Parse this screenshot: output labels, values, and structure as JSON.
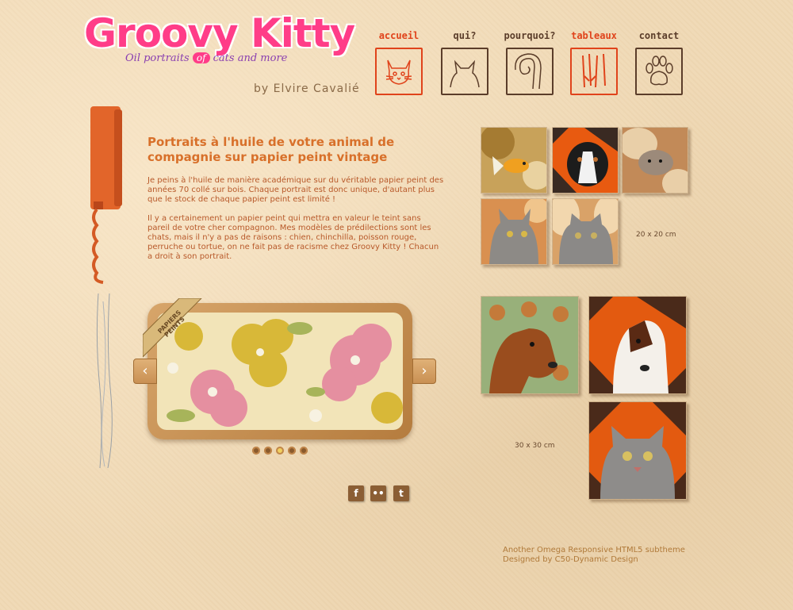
{
  "header": {
    "logo_text": "Groovy Kitty",
    "tagline_before": "Oil portraits ",
    "tagline_of": "of",
    "tagline_after": " cats and more",
    "byline": "by Elvire Cavalié"
  },
  "nav": {
    "items": [
      {
        "label": "accueil",
        "icon": "cat-face-icon",
        "active": true
      },
      {
        "label": "qui?",
        "icon": "cat-silhouette-icon",
        "active": false
      },
      {
        "label": "pourquoi?",
        "icon": "cat-tail-icon",
        "active": false
      },
      {
        "label": "tableaux",
        "icon": "claw-marks-icon",
        "active": true
      },
      {
        "label": "contact",
        "icon": "paw-print-icon",
        "active": false
      }
    ]
  },
  "intro": {
    "title": "Portraits à l'huile de votre animal de compagnie sur papier peint vintage",
    "paragraph1": "Je peins à l'huile de manière académique sur du véritable papier peint des années 70 collé sur bois. Chaque portrait est donc unique, d'autant plus que le stock de chaque papier peint est limité !",
    "paragraph2": "Il y a certainement un papier peint qui mettra en valeur le teint sans pareil de votre cher compagnon. Mes modèles de prédilections sont les chats, mais il n'y a pas de raisons : chien, chinchilla, poisson rouge, perruche ou tortue, on ne fait pas de racisme chez Groovy Kitty ! Chacun a droit à son portrait."
  },
  "slider": {
    "ribbon_text": "PAPIERS PEINTS",
    "prev_glyph": "‹",
    "next_glyph": "›",
    "dots": 5,
    "active_dot": 2
  },
  "gallery": {
    "small_size_label": "20 x 20 cm",
    "large_size_label": "30 x 30 cm",
    "small": [
      "goldfish-painting",
      "bernese-dog-painting",
      "hamster-painting",
      "tabby-cat-painting",
      "grey-cat-painting"
    ],
    "large": [
      "dachshund-painting",
      "terrier-painting",
      "grey-cat-orange-painting"
    ]
  },
  "social": {
    "facebook": "f",
    "flickr": "••",
    "twitter": "t"
  },
  "footer": {
    "line1": "Another Omega Responsive HTML5 subtheme",
    "line2": "Designed by C50-Dynamic Design"
  },
  "colors": {
    "accent": "#e0431b",
    "brand_pink": "#ff3d88",
    "brand_purple": "#9b3bd6",
    "text_orange": "#d8702a"
  }
}
